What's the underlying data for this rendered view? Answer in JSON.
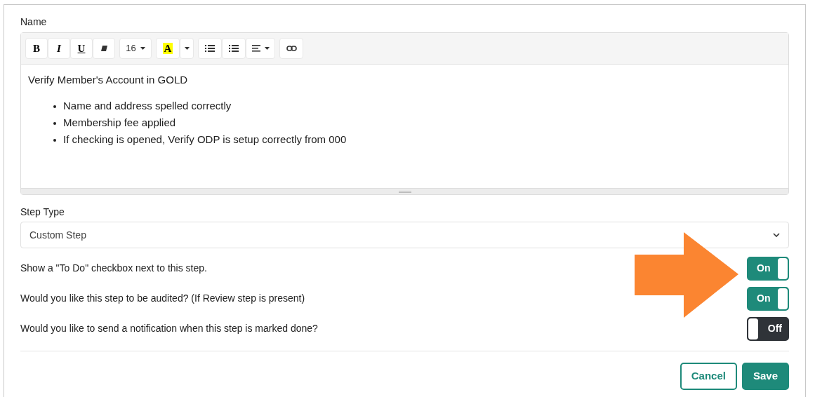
{
  "name_field": {
    "label": "Name",
    "toolbar": [
      {
        "kind": "bold",
        "text": "B"
      },
      {
        "kind": "italic",
        "text": "I"
      },
      {
        "kind": "underline",
        "text": "U"
      },
      {
        "kind": "eraser"
      },
      {
        "kind": "fontsize",
        "text": "16"
      },
      {
        "kind": "highlight",
        "text": "A"
      },
      {
        "kind": "bullets"
      },
      {
        "kind": "numbers"
      },
      {
        "kind": "align"
      },
      {
        "kind": "link"
      }
    ],
    "heading": "Verify Member's Account in GOLD",
    "bullets": [
      "Name and address spelled correctly",
      "Membership fee applied",
      "If checking is opened, Verify ODP is setup correctly from 000"
    ]
  },
  "step_type": {
    "label": "Step Type",
    "value": "Custom Step"
  },
  "options": [
    {
      "label": "Show a \"To Do\" checkbox next to this step.",
      "on": true,
      "state_text": "On"
    },
    {
      "label": "Would you like this step to be audited? (If Review step is present)",
      "on": true,
      "state_text": "On"
    },
    {
      "label": "Would you like to send a notification when this step is marked done?",
      "on": false,
      "state_text": "Off"
    }
  ],
  "buttons": [
    {
      "kind": "secondary",
      "label": "Cancel"
    },
    {
      "kind": "primary",
      "label": "Save"
    }
  ]
}
